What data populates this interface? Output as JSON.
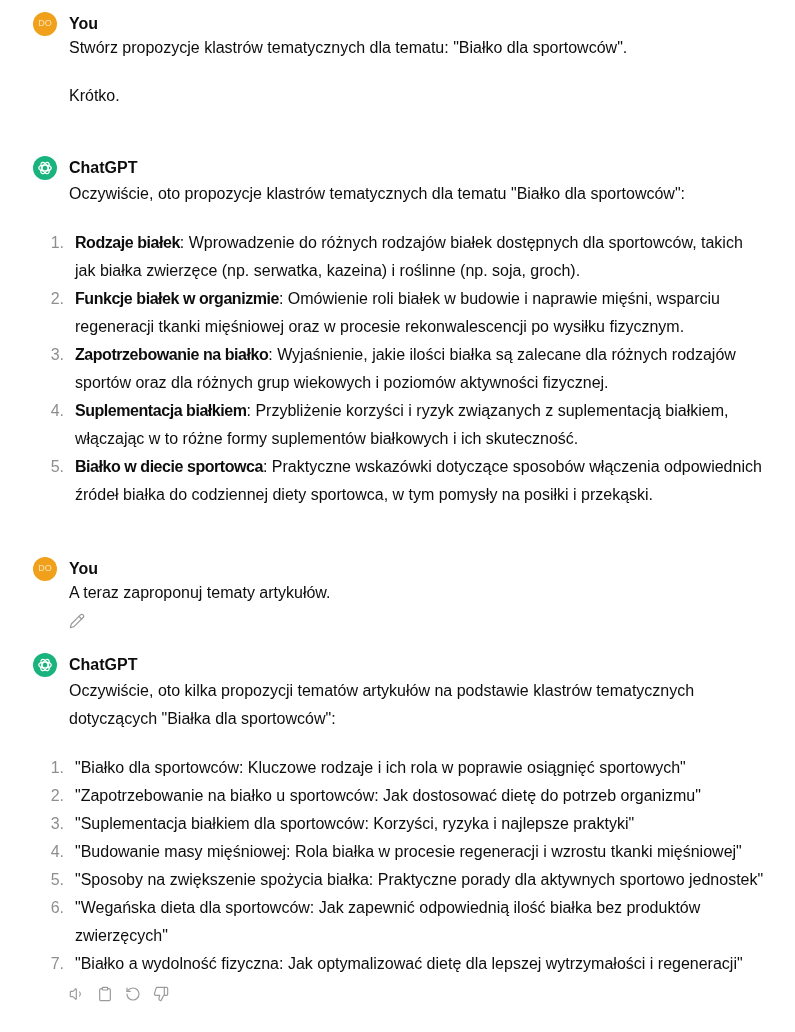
{
  "messages": [
    {
      "kind": "user",
      "avatar": "DO",
      "author": "You",
      "paragraphs": [
        "Stwórz propozycje klastrów tematycznych dla tematu: \"Białko dla sportowców\".",
        "Krótko."
      ]
    },
    {
      "kind": "assistant",
      "author": "ChatGPT",
      "intro": "Oczywiście, oto propozycje klastrów tematycznych dla tematu \"Białko dla sportowców\":",
      "list": [
        {
          "number": "1.",
          "text": "**Rodzaje białek**: Wprowadzenie do różnych rodzajów białek dostępnych dla sportowców, takich jak białka zwierzęce (np. serwatka, kazeina) i roślinne (np. soja, groch)."
        },
        {
          "number": "2.",
          "text": "**Funkcje białek w organizmie**: Omówienie roli białek w budowie i naprawie mięśni, wsparciu regeneracji tkanki mięśniowej oraz w procesie rekonwalescencji po wysiłku fizycznym."
        },
        {
          "number": "3.",
          "text": "**Zapotrzebowanie na białko**: Wyjaśnienie, jakie ilości białka są zalecane dla różnych rodzajów sportów oraz dla różnych grup wiekowych i poziomów aktywności fizycznej."
        },
        {
          "number": "4.",
          "text": "**Suplementacja białkiem**: Przybliżenie korzyści i ryzyk związanych z suplementacją białkiem, włączając w to różne formy suplementów białkowych i ich skuteczność."
        },
        {
          "number": "5.",
          "text": "**Białko w diecie sportowca**: Praktyczne wskazówki dotyczące sposobów włączenia odpowiednich źródeł białka do codziennej diety sportowca, w tym pomysły na posiłki i przekąski."
        }
      ]
    },
    {
      "kind": "user",
      "avatar": "DO",
      "author": "You",
      "paragraphs": [
        "A teraz zaproponuj tematy artykułów."
      ],
      "actions": [
        {
          "kind": "edit"
        }
      ]
    },
    {
      "kind": "assistant",
      "author": "ChatGPT",
      "intro": "Oczywiście, oto kilka propozycji tematów artykułów na podstawie klastrów tematycznych dotyczących \"Białka dla sportowców\":",
      "list": [
        {
          "number": "1.",
          "text": "\"Białko dla sportowców: Kluczowe rodzaje i ich rola w poprawie osiągnięć sportowych\""
        },
        {
          "number": "2.",
          "text": "\"Zapotrzebowanie na białko u sportowców: Jak dostosować dietę do potrzeb organizmu\""
        },
        {
          "number": "3.",
          "text": "\"Suplementacja białkiem dla sportowców: Korzyści, ryzyka i najlepsze praktyki\""
        },
        {
          "number": "4.",
          "text": "\"Budowanie masy mięśniowej: Rola białka w procesie regeneracji i wzrostu tkanki mięśniowej\""
        },
        {
          "number": "5.",
          "text": "\"Sposoby na zwiększenie spożycia białka: Praktyczne porady dla aktywnych sportowo jednostek\""
        },
        {
          "number": "6.",
          "text": "\"Wegańska dieta dla sportowców: Jak zapewnić odpowiednią ilość białka bez produktów zwierzęcych\""
        },
        {
          "number": "7.",
          "text": "\"Białko a wydolność fizyczna: Jak optymalizować dietę dla lepszej wytrzymałości i regeneracji\""
        }
      ],
      "actions": [
        {
          "kind": "read_aloud"
        },
        {
          "kind": "copy"
        },
        {
          "kind": "regenerate"
        },
        {
          "kind": "dislike"
        }
      ]
    }
  ]
}
